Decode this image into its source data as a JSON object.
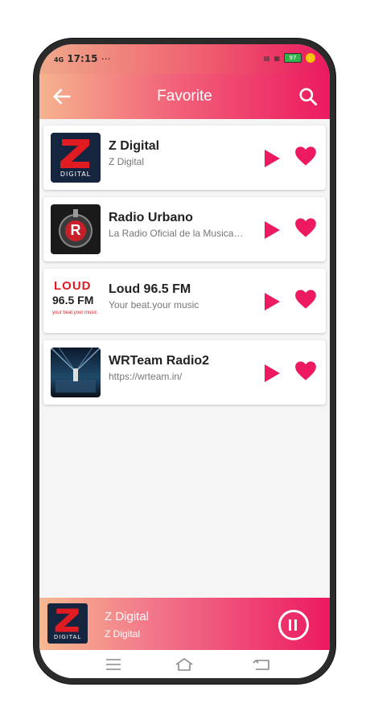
{
  "status_bar": {
    "time": "17:15",
    "signal": "4G",
    "battery": "97"
  },
  "app_bar": {
    "title": "Favorite"
  },
  "stations": [
    {
      "name": "Z Digital",
      "subtitle": "Z Digital",
      "logo": "z-digital-logo"
    },
    {
      "name": "Radio Urbano",
      "subtitle": "La Radio Oficial de la Musica Urbana",
      "logo": "radio-urbano-logo"
    },
    {
      "name": "Loud 96.5 FM",
      "subtitle": "Your beat.your music",
      "logo": "loud-965-logo"
    },
    {
      "name": "WRTeam Radio2",
      "subtitle": "https://wrteam.in/",
      "logo": "wrteam-stage-logo"
    }
  ],
  "logo_text": {
    "z_digital": "DIGITAL",
    "loud_top": "LOUD",
    "loud_freq": "96.5 FM",
    "loud_tag": "your beat.your music",
    "urbano": "R"
  },
  "now_playing": {
    "title": "Z Digital",
    "subtitle": "Z Digital"
  },
  "colors": {
    "accent": "#ec1a60",
    "gradient_start": "#f6b38e"
  }
}
